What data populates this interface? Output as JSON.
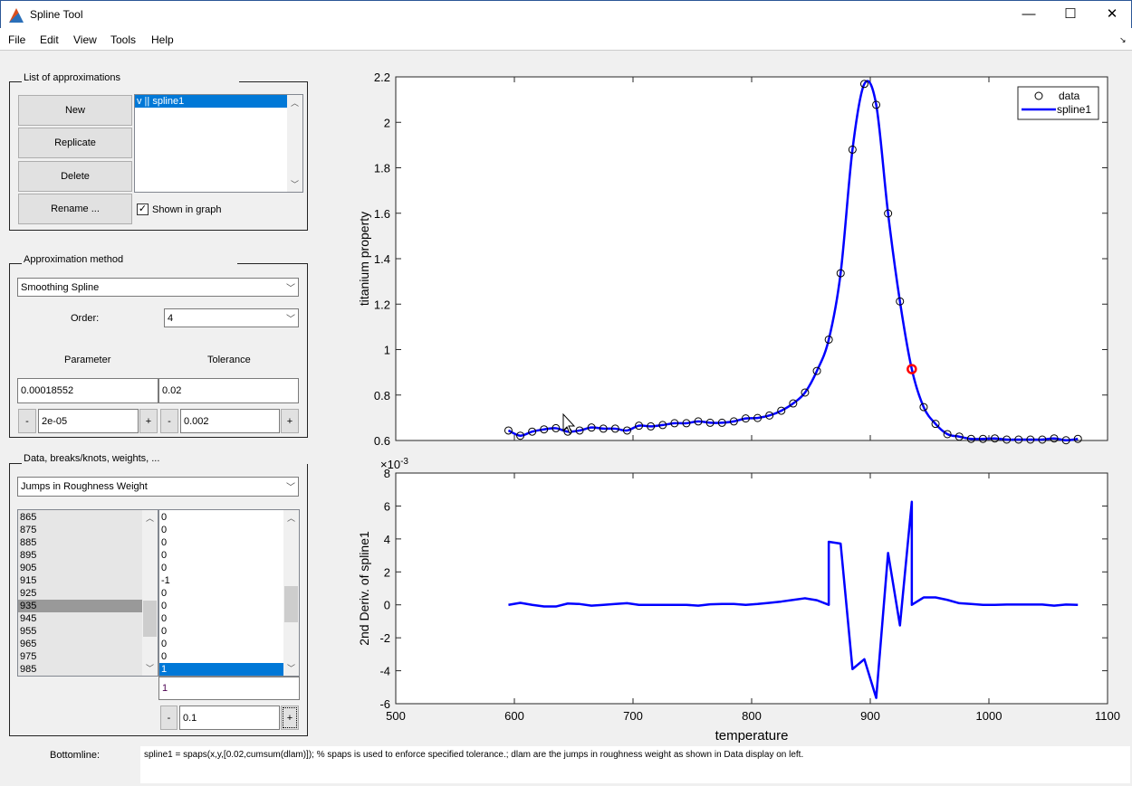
{
  "window": {
    "title": "Spline Tool",
    "minimize": "—",
    "maximize": "☐",
    "close": "✕"
  },
  "menu": [
    "File",
    "Edit",
    "View",
    "Tools",
    "Help"
  ],
  "approx_panel": {
    "title": "List of approximations",
    "buttons": [
      "New",
      "Replicate",
      "Delete",
      "Rename ..."
    ],
    "items": [
      "v || spline1"
    ],
    "shown_in_graph": "Shown in graph",
    "shown_checked": true
  },
  "method_panel": {
    "title": "Approximation method",
    "method": "Smoothing Spline",
    "order_label": "Order:",
    "order": "4",
    "parameter_label": "Parameter",
    "tolerance_label": "Tolerance",
    "parameter": "0.00018552",
    "tolerance": "0.02",
    "parameter_step": "2e-05",
    "tolerance_step": "0.002",
    "minus": "-",
    "plus": "+"
  },
  "data_panel": {
    "title": "Data, breaks/knots, weights, ...",
    "display": "Jumps in Roughness Weight",
    "x_list": [
      "865",
      "875",
      "885",
      "895",
      "905",
      "915",
      "925",
      "935",
      "945",
      "955",
      "965",
      "975",
      "985"
    ],
    "x_selected": "935",
    "value_list": [
      "0",
      "0",
      "0",
      "0",
      "0",
      "-1",
      "0",
      "0",
      "0",
      "0",
      "0",
      "0",
      "1"
    ],
    "value_selected_index": 12,
    "edit_value": "1",
    "step": "0.1",
    "minus": "-",
    "plus": "+"
  },
  "bottomline": {
    "label": "Bottomline:",
    "text": "spline1 = spaps(x,y,[0.02,cumsum(dlam)]); % spaps is used to enforce specified tolerance.; dlam are the jumps in roughness weight as shown in Data display on left."
  },
  "colors": {
    "spline": "#0000ff",
    "data_marker": "#000000",
    "highlight": "#ff0000",
    "selection": "#0078d7"
  },
  "chart_data": [
    {
      "type": "line",
      "xlabel": "",
      "ylabel": "titanium property",
      "xlim": [
        500,
        1100
      ],
      "ylim": [
        0.6,
        2.2
      ],
      "xticks": [
        500,
        600,
        700,
        800,
        900,
        1000,
        1100
      ],
      "yticks": [
        "0.6",
        "0.8",
        "1",
        "1.2",
        "1.4",
        "1.6",
        "1.8",
        "2",
        "2.2"
      ],
      "show_xtick_labels": false,
      "legend": {
        "placement": "top-right",
        "entries": [
          "data",
          "spline1"
        ]
      },
      "highlight_x": 935,
      "series": [
        {
          "name": "data",
          "style": "markers",
          "x": [
            595,
            605,
            615,
            625,
            635,
            645,
            655,
            665,
            675,
            685,
            695,
            705,
            715,
            725,
            735,
            745,
            755,
            765,
            775,
            785,
            795,
            805,
            815,
            825,
            835,
            845,
            855,
            865,
            875,
            885,
            895,
            905,
            915,
            925,
            935,
            945,
            955,
            965,
            975,
            985,
            995,
            1005,
            1015,
            1025,
            1035,
            1045,
            1055,
            1065,
            1075
          ],
          "y": [
            0.644,
            0.621,
            0.639,
            0.649,
            0.654,
            0.639,
            0.644,
            0.657,
            0.652,
            0.652,
            0.644,
            0.665,
            0.662,
            0.668,
            0.676,
            0.676,
            0.684,
            0.678,
            0.678,
            0.684,
            0.697,
            0.699,
            0.71,
            0.731,
            0.763,
            0.811,
            0.906,
            1.044,
            1.336,
            1.88,
            2.169,
            2.077,
            1.599,
            1.212,
            0.914,
            0.747,
            0.673,
            0.628,
            0.617,
            0.607,
            0.607,
            0.609,
            0.604,
            0.604,
            0.604,
            0.604,
            0.609,
            0.601,
            0.607
          ]
        },
        {
          "name": "spline1",
          "style": "line"
        }
      ]
    },
    {
      "type": "line",
      "xlabel": "temperature",
      "ylabel": "2nd Deriv. of spline1",
      "xlim": [
        500,
        1100
      ],
      "ylim": [
        -6,
        8
      ],
      "yscale_label": "×10",
      "yscale_exp": "-3",
      "xticks": [
        "500",
        "600",
        "700",
        "800",
        "900",
        "1000",
        "1100"
      ],
      "yticks": [
        "-6",
        "-4",
        "-2",
        "0",
        "2",
        "4",
        "6",
        "8"
      ],
      "series": [
        {
          "name": "spline1",
          "x": [
            595,
            605,
            615,
            625,
            635,
            645,
            655,
            665,
            675,
            685,
            695,
            705,
            715,
            725,
            735,
            745,
            755,
            765,
            775,
            785,
            795,
            805,
            815,
            825,
            835,
            845,
            855,
            865,
            865,
            875,
            885,
            895,
            905,
            915,
            925,
            935,
            935,
            945,
            955,
            965,
            975,
            985,
            995,
            1005,
            1015,
            1025,
            1035,
            1045,
            1055,
            1065,
            1075
          ],
          "y": [
            0.0,
            0.12,
            0.0,
            -0.1,
            -0.1,
            0.08,
            0.05,
            -0.05,
            0.0,
            0.05,
            0.1,
            0.0,
            0.0,
            0.0,
            0.0,
            0.0,
            -0.05,
            0.03,
            0.05,
            0.05,
            0.0,
            0.05,
            0.12,
            0.2,
            0.3,
            0.4,
            0.28,
            0.0,
            3.83,
            3.72,
            -3.9,
            -3.3,
            -5.65,
            3.15,
            -1.25,
            6.26,
            0.0,
            0.45,
            0.45,
            0.3,
            0.1,
            0.05,
            0.0,
            0.0,
            0.02,
            0.02,
            0.02,
            0.02,
            -0.05,
            0.02,
            0.0
          ]
        }
      ]
    }
  ]
}
